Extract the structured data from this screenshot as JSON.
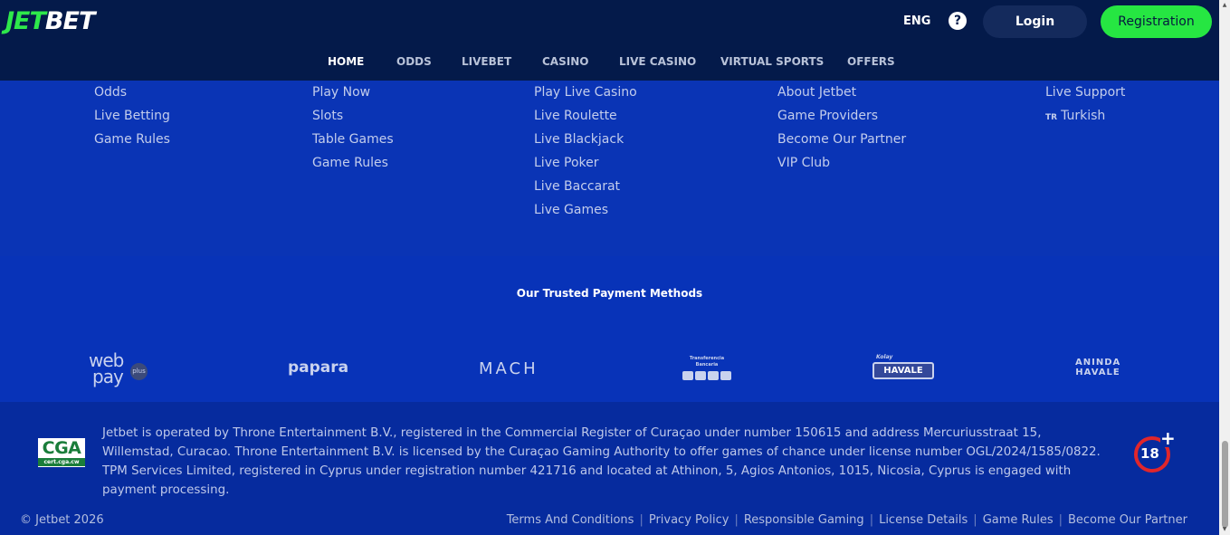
{
  "header": {
    "logo_left": "JET",
    "logo_right": "BET",
    "lang": "ENG",
    "help_glyph": "?",
    "login": "Login",
    "register": "Registration",
    "nav": [
      "HOME",
      "ODDS",
      "LIVEBET",
      "CASINO",
      "LIVE CASINO",
      "VIRTUAL SPORTS",
      "OFFERS"
    ]
  },
  "columns": [
    [
      "Odds",
      "Live Betting",
      "Game Rules"
    ],
    [
      "Play Now",
      "Slots",
      "Table Games",
      "Game Rules"
    ],
    [
      "Play Live Casino",
      "Live Roulette",
      "Live Blackjack",
      "Live Poker",
      "Live Baccarat",
      "Live Games"
    ],
    [
      "About Jetbet",
      "Game Providers",
      "Become Our Partner",
      "VIP Club"
    ],
    [
      "Live Support",
      "Turkish"
    ]
  ],
  "turkish_flag_code": "TR",
  "payments": {
    "title": "Our Trusted Payment Methods",
    "webpay_top": "web",
    "webpay_bottom": "pay",
    "webpay_plus": "plus",
    "papara": "papara",
    "mach": "MACH",
    "transfer_line1": "Transferencia",
    "transfer_line2": "Bancaria",
    "havale_small": "Kolay",
    "havale": "HAVALE",
    "aninda_line1": "ANINDA",
    "aninda_line2": "HAVALE"
  },
  "legal": {
    "cga_big": "CGA",
    "cga_small": "cert.cga.cw",
    "text": "Jetbet is operated by Throne Entertainment B.V., registered in the Commercial Register of Curaçao under number 150615 and address Mercuriusstraat 15, Willemstad, Curacao. Throne Entertainment B.V. is licensed by the Curaçao Gaming Authority to offer games of chance under license number OGL/2024/1585/0822. TPM Services Limited, registered in Cyprus under registration number 421716 and located at Athinon, 5, Agios Antonios, 1015, Nicosia, Cyprus is engaged with payment processing.",
    "age": "18",
    "age_plus": "+",
    "copyright": "© Jetbet 2026",
    "links": [
      "Terms And Conditions",
      "Privacy Policy",
      "Responsible Gaming",
      "License Details",
      "Game Rules",
      "Become Our Partner"
    ]
  },
  "colors": {
    "header_bg": "#041a4a",
    "accent_green": "#26e642",
    "footer_blue": "#0833b8",
    "age_red": "#e0262b"
  }
}
